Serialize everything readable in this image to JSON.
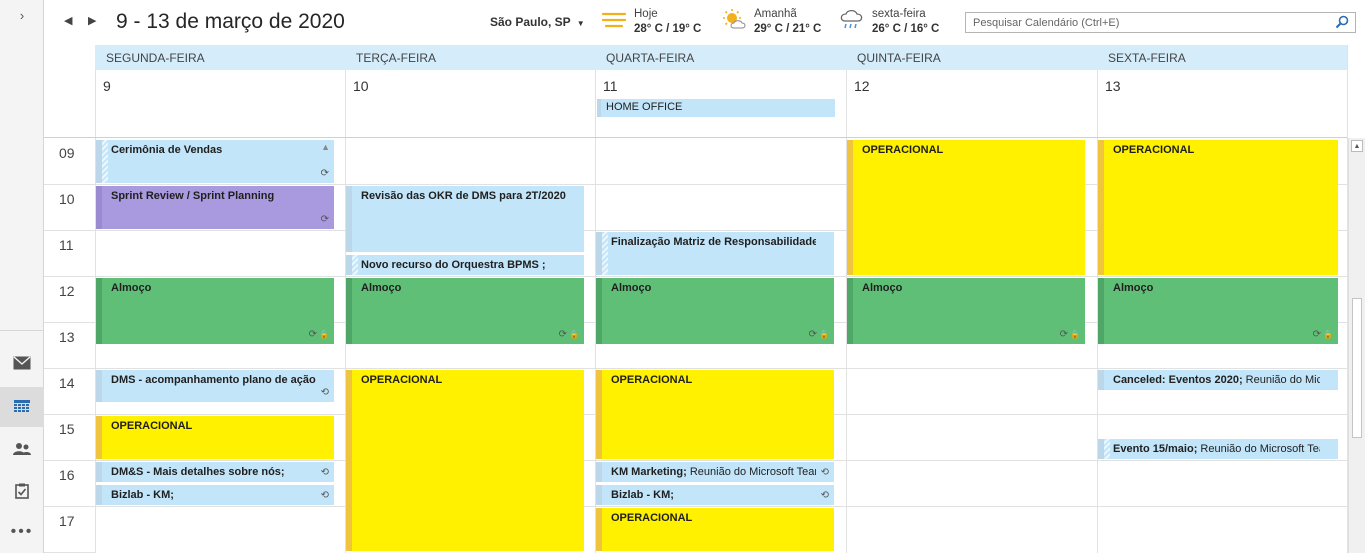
{
  "header": {
    "prev_glyph": "◀",
    "next_glyph": "▶",
    "date_range": "9 - 13 de março de 2020",
    "location": "São Paulo, SP",
    "location_caret": "▼",
    "weather": [
      {
        "label": "Hoje",
        "temp": "28° C / 19° C",
        "icon": "sun-icon"
      },
      {
        "label": "Amanhã",
        "temp": "29° C / 21° C",
        "icon": "partly-sunny-icon"
      },
      {
        "label": "sexta-feira",
        "temp": "26° C / 16° C",
        "icon": "rain-icon"
      }
    ],
    "search_placeholder": "Pesquisar Calendário (Ctrl+E)"
  },
  "nav": {
    "expand_glyph": "›",
    "more_glyph": "•••",
    "items": [
      "mail-icon",
      "calendar-icon",
      "people-icon",
      "tasks-icon"
    ]
  },
  "days": [
    {
      "name": "SEGUNDA-FEIRA",
      "num": "9"
    },
    {
      "name": "TERÇA-FEIRA",
      "num": "10"
    },
    {
      "name": "QUARTA-FEIRA",
      "num": "11"
    },
    {
      "name": "QUINTA-FEIRA",
      "num": "12"
    },
    {
      "name": "SEXTA-FEIRA",
      "num": "13"
    }
  ],
  "hours": [
    "09",
    "10",
    "11",
    "12",
    "13",
    "14",
    "15",
    "16",
    "17"
  ],
  "allday": [
    {
      "day": 2,
      "title": "HOME OFFICE"
    }
  ],
  "events": [
    {
      "day": 0,
      "start": 9,
      "end": 10,
      "title": "Cerimônia de Vendas",
      "color": "blue",
      "tent": true,
      "recurring": true,
      "up": true
    },
    {
      "day": 0,
      "start": 10,
      "end": 11,
      "title": "Sprint Review / Sprint Planning",
      "color": "purple",
      "recurring": true
    },
    {
      "day": 0,
      "start": 12,
      "end": 13.5,
      "title": "Almoço",
      "color": "green",
      "recurring": true,
      "private": true
    },
    {
      "day": 0,
      "start": 14,
      "end": 14.75,
      "title": "DMS - acompanhamento plano de ação",
      "color": "blue",
      "recurring_ex": true
    },
    {
      "day": 0,
      "start": 15,
      "end": 16,
      "title": "OPERACIONAL",
      "color": "yellow"
    },
    {
      "day": 0,
      "start": 16,
      "end": 16.5,
      "title": "DM&S - Mais detalhes sobre nós;",
      "color": "blue",
      "recurring_ex": true
    },
    {
      "day": 0,
      "start": 16.5,
      "end": 17,
      "title": "Bizlab - KM;",
      "color": "blue",
      "recurring_ex": true
    },
    {
      "day": 1,
      "start": 10,
      "end": 11.5,
      "title": "Revisão das OKR de DMS para 2T/2020",
      "color": "blue"
    },
    {
      "day": 1,
      "start": 11.5,
      "end": 12,
      "title": "Novo recurso do Orquestra BPMS ;",
      "color": "blue",
      "tent": true
    },
    {
      "day": 1,
      "start": 12,
      "end": 13.5,
      "title": "Almoço",
      "color": "green",
      "recurring": true,
      "private": true
    },
    {
      "day": 1,
      "start": 14,
      "end": 18,
      "title": "OPERACIONAL",
      "color": "yellow"
    },
    {
      "day": 2,
      "start": 11,
      "end": 12,
      "title": "Finalização Matriz de Responsabilidades",
      "color": "blue",
      "tent": true
    },
    {
      "day": 2,
      "start": 12,
      "end": 13.5,
      "title": "Almoço",
      "color": "green",
      "recurring": true,
      "private": true
    },
    {
      "day": 2,
      "start": 14,
      "end": 16,
      "title": "OPERACIONAL",
      "color": "yellow"
    },
    {
      "day": 2,
      "start": 16,
      "end": 16.5,
      "title": "KM Marketing;",
      "rest": " Reunião do Microsoft Teams",
      "color": "blue",
      "recurring_ex": true
    },
    {
      "day": 2,
      "start": 16.5,
      "end": 17,
      "title": "Bizlab - KM;",
      "color": "blue",
      "recurring_ex": true
    },
    {
      "day": 2,
      "start": 17,
      "end": 18,
      "title": "OPERACIONAL",
      "color": "yellow"
    },
    {
      "day": 3,
      "start": 9,
      "end": 12,
      "title": "OPERACIONAL",
      "color": "yellow"
    },
    {
      "day": 3,
      "start": 12,
      "end": 13.5,
      "title": "Almoço",
      "color": "green",
      "recurring": true,
      "private": true
    },
    {
      "day": 4,
      "start": 9,
      "end": 12,
      "title": "OPERACIONAL",
      "color": "yellow"
    },
    {
      "day": 4,
      "start": 12,
      "end": 13.5,
      "title": "Almoço",
      "color": "green",
      "recurring": true,
      "private": true
    },
    {
      "day": 4,
      "start": 14,
      "end": 14.5,
      "title": "Canceled: Eventos 2020;",
      "rest": " Reunião do Microsoft Teams",
      "color": "blue"
    },
    {
      "day": 4,
      "start": 15.5,
      "end": 16,
      "title": "Evento 15/maio;",
      "rest": " Reunião do Microsoft Teams",
      "color": "blue",
      "tent": true
    }
  ],
  "glyphs": {
    "recurring": "⟳",
    "recurring_ex": "⟲",
    "private": "🔒",
    "up": "▲"
  }
}
